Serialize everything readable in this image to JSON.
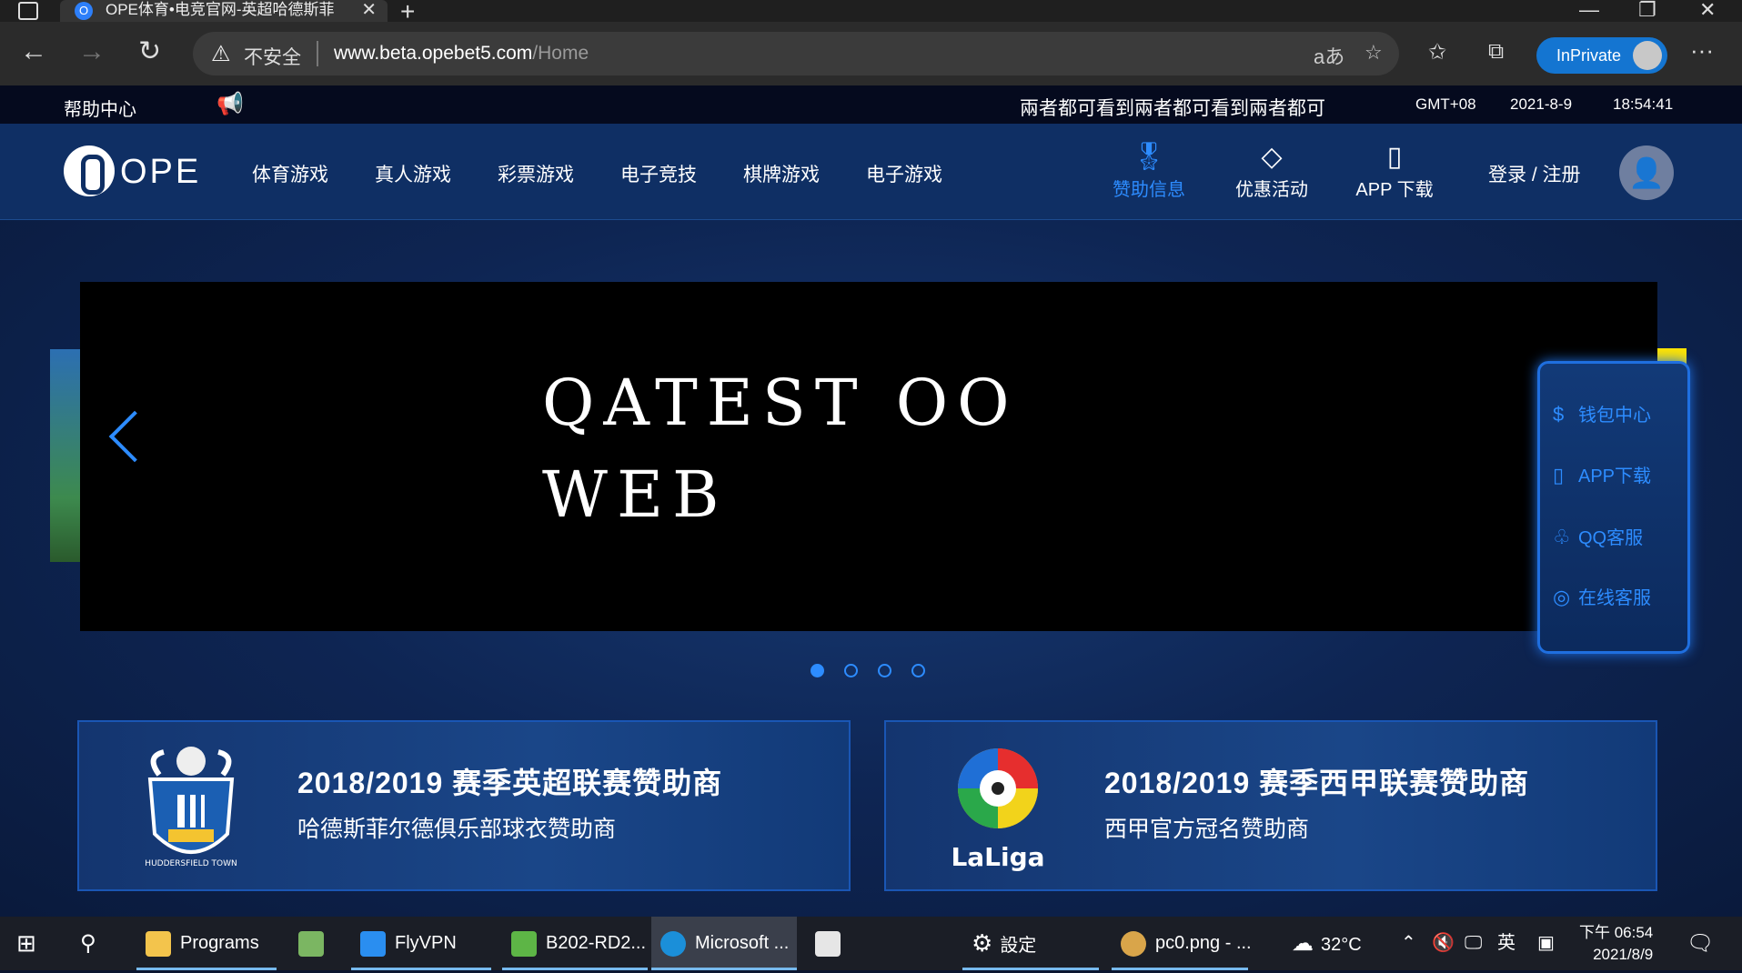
{
  "browser": {
    "tab_title": "OPE体育•电竞官网-英超哈德斯菲",
    "tab_close": "✕",
    "new_tab": "+",
    "insecure_label": "不安全",
    "url_host": "www.beta.opebet5.com",
    "url_path": "/Home",
    "inprivate_label": "InPrivate"
  },
  "site": {
    "infobar": {
      "help": "帮助中心",
      "marquee": "兩者都可看到兩者都可看到兩者都可",
      "timezone": "GMT+08",
      "date": "2021-8-9",
      "time": "18:54:41"
    },
    "logo_text": "OPE",
    "menu": [
      "体育游戏",
      "真人游戏",
      "彩票游戏",
      "电子竞技",
      "棋牌游戏",
      "电子游戏"
    ],
    "icon_menu": [
      {
        "label": "赞助信息",
        "icon": "award-icon",
        "active": true
      },
      {
        "label": "优惠活动",
        "icon": "diamond-icon",
        "active": false
      },
      {
        "label": "APP 下载",
        "icon": "phone-icon",
        "active": false
      }
    ],
    "login_label": "登录 / 注册",
    "banner": {
      "line1": "QATEST OO",
      "line2": "WEB",
      "slides_total": 4,
      "slide_active": 1
    },
    "side_panel": [
      {
        "label": "钱包中心",
        "icon": "wallet-icon"
      },
      {
        "label": "APP下载",
        "icon": "phone-icon"
      },
      {
        "label": "QQ客服",
        "icon": "qq-icon"
      },
      {
        "label": "在线客服",
        "icon": "globe-icon"
      }
    ],
    "sponsors": [
      {
        "title": "2018/2019 赛季英超联赛赞助商",
        "subtitle": "哈德斯菲尔德俱乐部球衣赞助商",
        "crest_label": "HUDDERSFIELD TOWN"
      },
      {
        "title": "2018/2019 赛季西甲联赛赞助商",
        "subtitle": "西甲官方冠名赞助商",
        "crest_label": "LaLiga"
      }
    ]
  },
  "taskbar": {
    "items": [
      "Programs",
      "FlyVPN",
      "B202-RD2...",
      "Microsoft ...",
      "設定",
      "pc0.png - ..."
    ],
    "weather": "32°C",
    "ime": "英",
    "clock_time": "下午 06:54",
    "clock_date": "2021/8/9"
  },
  "colors": {
    "accent": "#2d8cff",
    "nav_bg": "#0f2f64",
    "banner_bg": "#000000",
    "highlight": "#ffe400"
  }
}
